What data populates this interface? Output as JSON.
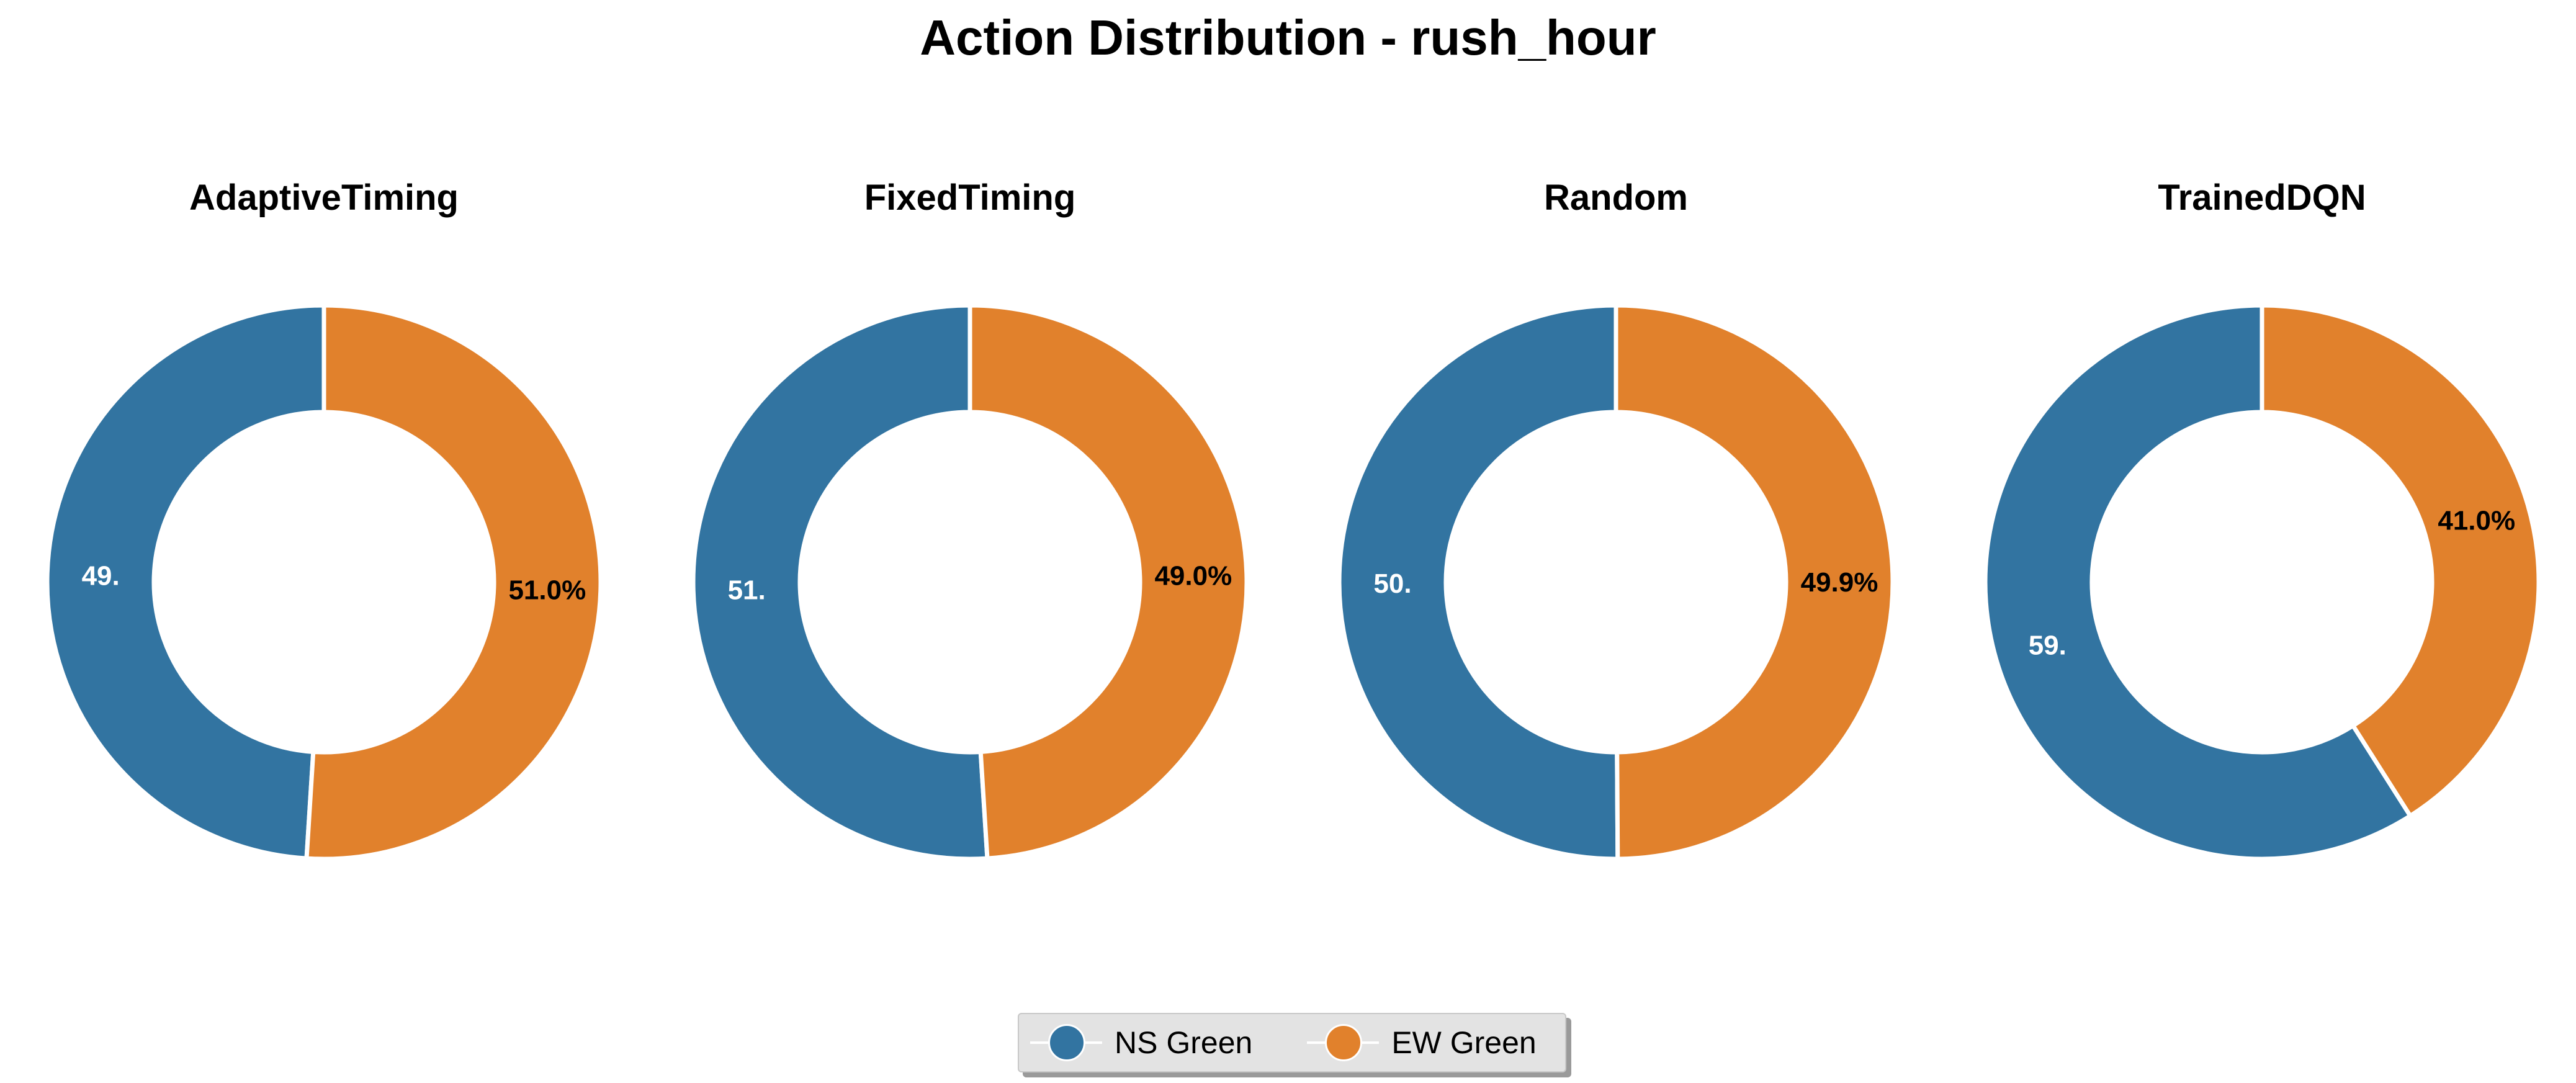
{
  "figure": {
    "title": "Action Distribution - rush_hour"
  },
  "legend": {
    "items": [
      {
        "label": "NS Green",
        "color": "#3274a1"
      },
      {
        "label": "EW Green",
        "color": "#e1812c"
      }
    ]
  },
  "chart_data": [
    {
      "type": "pie",
      "title": "AdaptiveTiming",
      "categories": [
        "NS Green",
        "EW Green"
      ],
      "values": [
        49.0,
        51.0
      ],
      "data_labels": [
        "49.",
        "51.0%"
      ],
      "colors": [
        "#3274a1",
        "#e1812c"
      ],
      "donut": true
    },
    {
      "type": "pie",
      "title": "FixedTiming",
      "categories": [
        "NS Green",
        "EW Green"
      ],
      "values": [
        51.0,
        49.0
      ],
      "data_labels": [
        "51.",
        "49.0%"
      ],
      "colors": [
        "#3274a1",
        "#e1812c"
      ],
      "donut": true
    },
    {
      "type": "pie",
      "title": "Random",
      "categories": [
        "NS Green",
        "EW Green"
      ],
      "values": [
        50.1,
        49.9
      ],
      "data_labels": [
        "50.",
        "49.9%"
      ],
      "colors": [
        "#3274a1",
        "#e1812c"
      ],
      "donut": true
    },
    {
      "type": "pie",
      "title": "TrainedDQN",
      "categories": [
        "NS Green",
        "EW Green"
      ],
      "values": [
        59.0,
        41.0
      ],
      "data_labels": [
        "59.",
        "41.0%"
      ],
      "colors": [
        "#3274a1",
        "#e1812c"
      ],
      "donut": true
    }
  ]
}
